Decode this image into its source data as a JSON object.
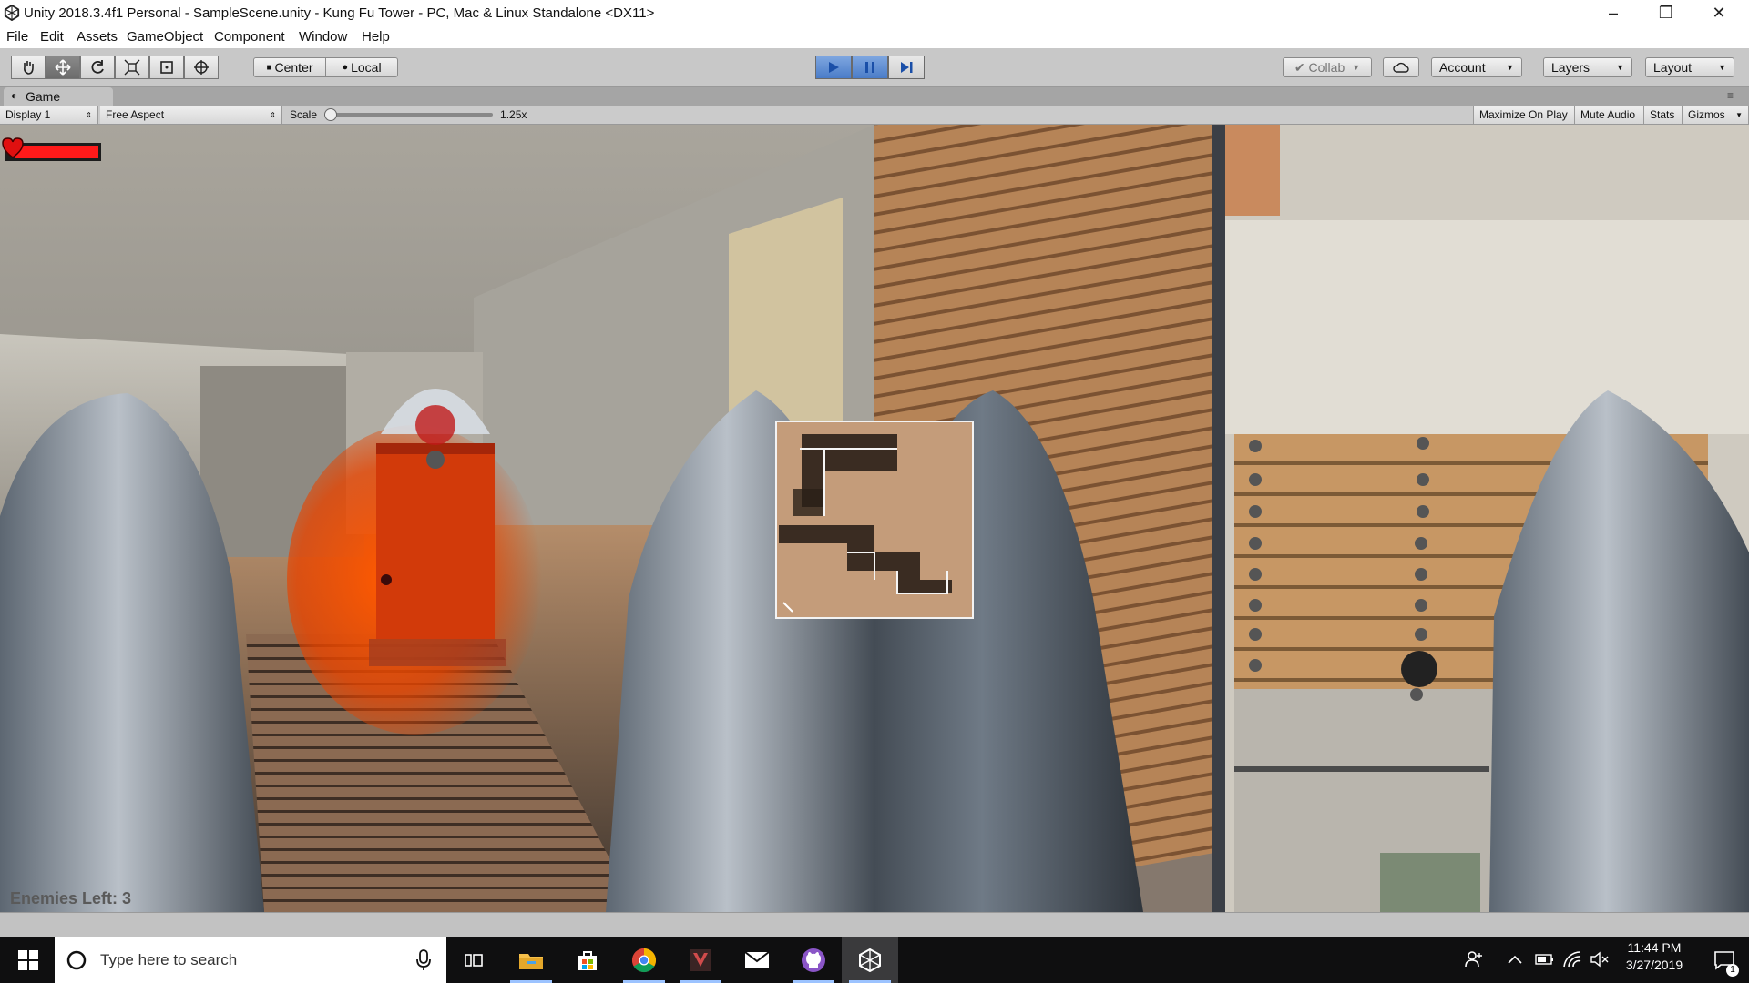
{
  "window": {
    "title": "Unity 2018.3.4f1 Personal - SampleScene.unity - Kung Fu Tower - PC, Mac & Linux Standalone <DX11>",
    "controls": {
      "minimize": "–",
      "restore": "❐",
      "close": "✕"
    }
  },
  "menu": [
    "File",
    "Edit",
    "Assets",
    "GameObject",
    "Component",
    "Window",
    "Help"
  ],
  "toolbar": {
    "tools": [
      "hand-tool",
      "move-tool",
      "rotate-tool",
      "scale-tool",
      "rect-tool",
      "transform-tool"
    ],
    "pivot_label": "Center",
    "space_label": "Local",
    "collab_label": "Collab",
    "account_label": "Account",
    "layers_label": "Layers",
    "layout_label": "Layout",
    "play_state": "playing"
  },
  "game_tab": {
    "label": "Game",
    "display": "Display 1",
    "aspect": "Free Aspect",
    "scale_label": "Scale",
    "scale_value": "1.25x",
    "scale_fraction": 0.0,
    "maximize_label": "Maximize On Play",
    "mute_label": "Mute Audio",
    "stats_label": "Stats",
    "gizmos_label": "Gizmos"
  },
  "hud": {
    "health_fraction": 1.0,
    "health_color": "#ff1a1a",
    "enemies_left": "Enemies Left: 3"
  },
  "taskbar": {
    "search_placeholder": "Type here to search",
    "apps": [
      "task-view-icon",
      "file-explorer-icon",
      "store-icon",
      "chrome-icon",
      "gaming-app-icon",
      "mail-icon",
      "github-icon",
      "unity-icon"
    ],
    "time": "11:44 PM",
    "date": "3/27/2019",
    "notification_count": "1"
  }
}
